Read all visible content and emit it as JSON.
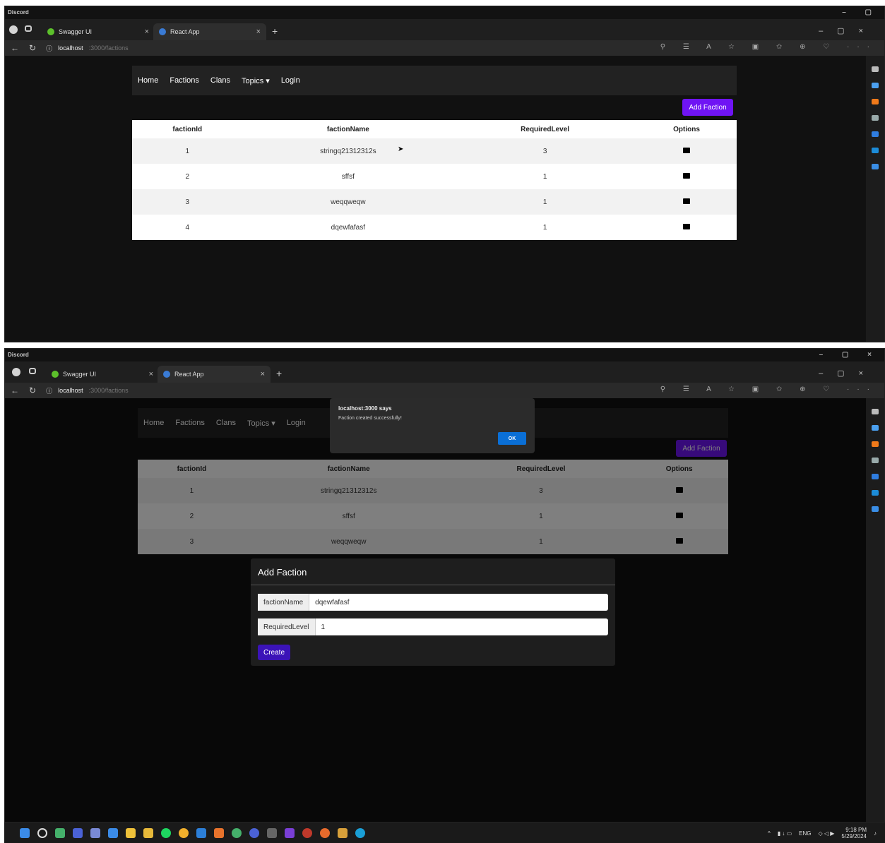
{
  "app_title": "Discord",
  "tabs": [
    {
      "label": "Swagger UI"
    },
    {
      "label": "React App"
    }
  ],
  "address": {
    "host": "localhost",
    "path": ":3000/factions"
  },
  "nav": {
    "links": [
      "Home",
      "Factions",
      "Clans",
      "Topics ▾",
      "Login"
    ]
  },
  "add_faction_label": "Add Faction",
  "table": {
    "headers": [
      "factionId",
      "factionName",
      "RequiredLevel",
      "Options"
    ],
    "rows_top": [
      {
        "id": "1",
        "name": "stringq21312312s",
        "level": "3"
      },
      {
        "id": "2",
        "name": "sffsf",
        "level": "1"
      },
      {
        "id": "3",
        "name": "weqqweqw",
        "level": "1"
      },
      {
        "id": "4",
        "name": "dqewfafasf",
        "level": "1"
      }
    ],
    "rows_bottom": [
      {
        "id": "1",
        "name": "stringq21312312s",
        "level": "3"
      },
      {
        "id": "2",
        "name": "sffsf",
        "level": "1"
      },
      {
        "id": "3",
        "name": "weqqweqw",
        "level": "1"
      }
    ]
  },
  "alert": {
    "title": "localhost:3000 says",
    "message": "Faction created successfully!",
    "ok": "OK"
  },
  "modal": {
    "title": "Add Faction",
    "fields": [
      {
        "label": "factionName",
        "value": "dqewfafasf"
      },
      {
        "label": "RequiredLevel",
        "value": "1"
      }
    ],
    "create_label": "Create"
  },
  "taskbar": {
    "lang": "ENG",
    "time": "9:18 PM",
    "date": "5/29/2024"
  },
  "colors": {
    "accent": "#6f14f4",
    "ok_button": "#0a6fd6",
    "navbar": "#222222"
  }
}
